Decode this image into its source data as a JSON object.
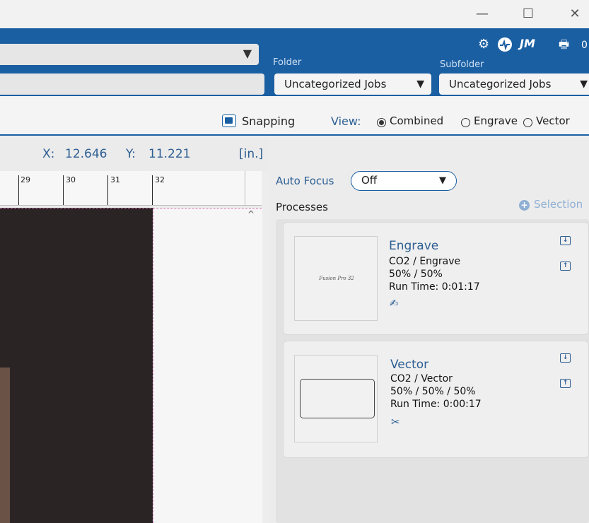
{
  "window": {
    "minimize": "—",
    "maximize": "☐",
    "close": "✕"
  },
  "header": {
    "folder_label": "Folder",
    "folder_value": "Uncategorized Jobs",
    "subfolder_label": "Subfolder",
    "subfolder_value": "Uncategorized Jobs",
    "user_initials": "JM",
    "count": "0",
    "icons": [
      "gear-icon",
      "pulse-icon",
      "printer-icon"
    ],
    "brand_color": "#1b5fa3"
  },
  "toolbar": {
    "snapping_label": "Snapping",
    "snapping_checked": true,
    "view_label": "View:",
    "view_options": [
      "Combined",
      "Engrave",
      "Vector"
    ],
    "view_selected": "Combined"
  },
  "coords": {
    "x_label": "X:",
    "x_value": "12.646",
    "y_label": "Y:",
    "y_value": "11.221",
    "units": "[in.]"
  },
  "ruler": {
    "ticks": [
      "29",
      "30",
      "31",
      "32"
    ]
  },
  "autofocus": {
    "label": "Auto Focus",
    "value": "Off"
  },
  "processes": {
    "label": "Processes",
    "selection_label": "Selection",
    "items": [
      {
        "name": "Engrave",
        "type": "CO2 / Engrave",
        "settings": "50% / 50%",
        "run_time": "Run Time: 0:01:17",
        "thumb_text": "Fusion Pro 32",
        "icon": "engrave-icon"
      },
      {
        "name": "Vector",
        "type": "CO2 / Vector",
        "settings": "50% / 50% / 50%",
        "run_time": "Run Time: 0:00:17",
        "icon": "scissors-icon"
      }
    ]
  }
}
